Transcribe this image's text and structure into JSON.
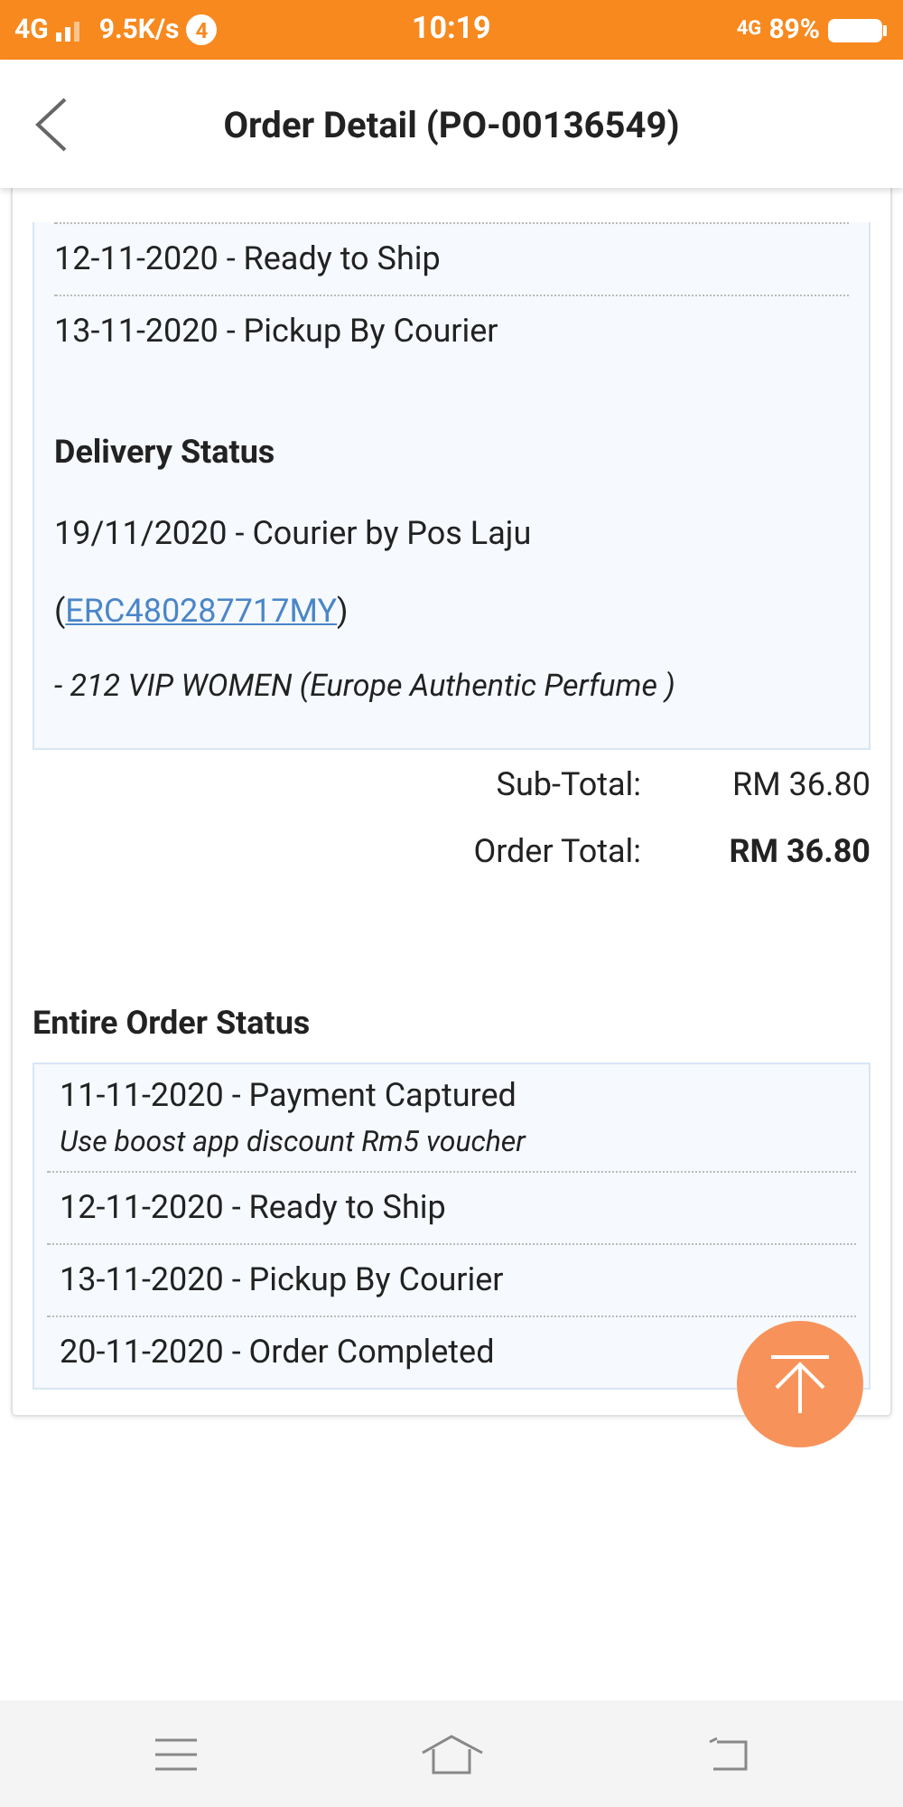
{
  "status_bar": {
    "network": "4G",
    "speed": "9.5K/s",
    "notification_count": "4",
    "time": "10:19",
    "network_right": "4G",
    "battery": "89%"
  },
  "header": {
    "title": "Order Detail (PO-00136549)"
  },
  "item_status": [
    {
      "text": "12-11-2020 - Ready to Ship"
    },
    {
      "text": "13-11-2020 - Pickup By Courier"
    }
  ],
  "delivery": {
    "heading": "Delivery Status",
    "line": "19/11/2020 - Courier by Pos Laju",
    "open_paren": "(",
    "tracking": "ERC480287717MY",
    "close_paren": ")",
    "product": "- 212 VIP WOMEN (Europe Authentic Perfume )"
  },
  "totals": [
    {
      "label": "Sub-Total:",
      "value": "RM 36.80",
      "bold": false
    },
    {
      "label": "Order Total:",
      "value": "RM 36.80",
      "bold": true
    }
  ],
  "entire_order": {
    "heading": "Entire Order Status",
    "rows": [
      {
        "text": "11-11-2020 - Payment Captured",
        "note": "Use boost app discount Rm5 voucher"
      },
      {
        "text": "12-11-2020 - Ready to Ship"
      },
      {
        "text": "13-11-2020 - Pickup By Courier"
      },
      {
        "text": "20-11-2020 - Order Completed"
      }
    ]
  }
}
